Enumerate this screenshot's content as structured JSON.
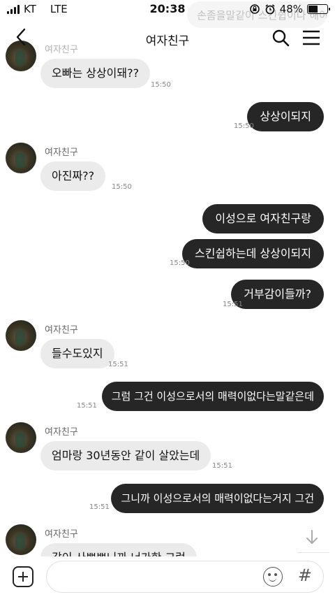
{
  "status_bar": {
    "carrier": "KT",
    "network": "LTE",
    "time": "20:38",
    "battery": "48%",
    "battery_level": 0.48
  },
  "ghost_preview": "손좀을말같이 스킨쉽이나 해야지",
  "nav": {
    "title": "여자친구"
  },
  "friend_name": "여자친구",
  "messages": [
    {
      "side": "in",
      "text": "오빠는 상상이돼??",
      "time": "15:50"
    },
    {
      "side": "out",
      "text": "상상이되지",
      "time": "15:50"
    },
    {
      "side": "in",
      "sender": "여자친구",
      "text": "아진짜??",
      "time": "15:50"
    },
    {
      "side": "out",
      "text": "이성으로 여자친구랑",
      "time": ""
    },
    {
      "side": "out",
      "text": "스킨쉽하는데 상상이되지",
      "time": "15:50"
    },
    {
      "side": "out",
      "text": "거부감이들까?",
      "time": "15:51"
    },
    {
      "side": "in",
      "sender": "여자친구",
      "text": "들수도있지",
      "time": "15:51"
    },
    {
      "side": "out",
      "text": "그럼 그건 이성으로서의 매력이없다는말같은데",
      "time": "15:51"
    },
    {
      "side": "in",
      "sender": "여자친구",
      "text": "엄마랑 30년동안 같이 살았는데",
      "time": "15:51"
    },
    {
      "side": "out",
      "text": "그니까 이성으로서의 매력이없다는거지 그건",
      "time": "15:51"
    },
    {
      "side": "in",
      "sender": "여자친구",
      "text": "같이 사쁘쁘니까 너가한 그런",
      "time": ""
    }
  ],
  "composer": {
    "placeholder": "",
    "hash_label": "#"
  }
}
